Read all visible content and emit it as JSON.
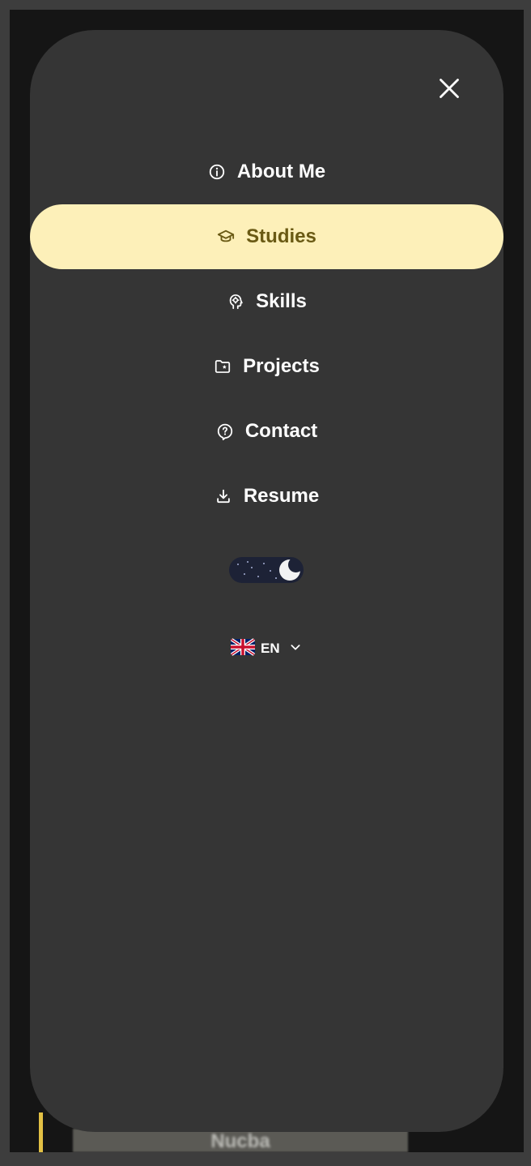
{
  "background": {
    "card_text": "Nucba"
  },
  "menu": {
    "close_icon": "close-icon",
    "active_color": "#fdf0b9",
    "active_text_color": "#6a5a14",
    "items": [
      {
        "label": "About Me",
        "icon": "info-icon",
        "active": false
      },
      {
        "label": "Studies",
        "icon": "graduation-cap-icon",
        "active": true
      },
      {
        "label": "Skills",
        "icon": "head-idea-icon",
        "active": false
      },
      {
        "label": "Projects",
        "icon": "folder-star-icon",
        "active": false
      },
      {
        "label": "Contact",
        "icon": "help-bubble-icon",
        "active": false
      },
      {
        "label": "Resume",
        "icon": "download-icon",
        "active": false
      }
    ],
    "theme_toggle": {
      "mode": "dark",
      "icon": "moon-icon"
    },
    "language": {
      "code": "EN",
      "flag": "uk-flag-icon"
    }
  }
}
